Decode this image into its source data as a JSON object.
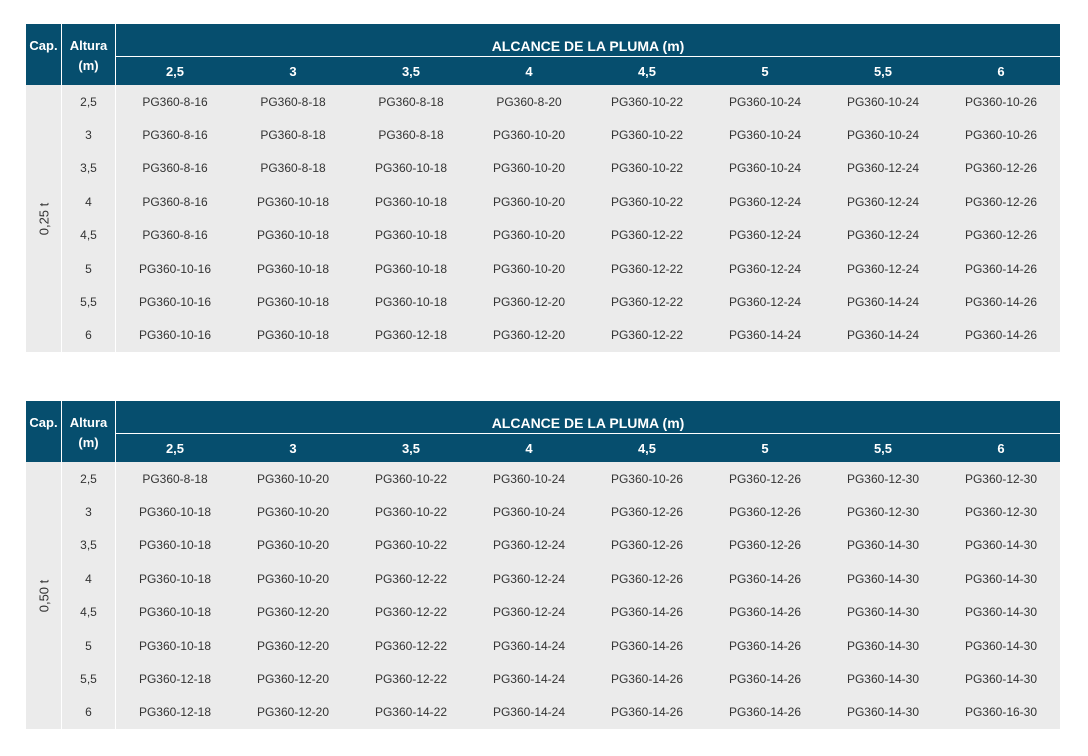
{
  "tables": [
    {
      "cap_header": "Cap.",
      "alt_header_line1": "Altura",
      "alt_header_line2": "(m)",
      "span_header": "ALCANCE DE LA PLUMA (m)",
      "reach": [
        "2,5",
        "3",
        "3,5",
        "4",
        "4,5",
        "5",
        "5,5",
        "6"
      ],
      "capacity": "0,25 t",
      "rows": [
        {
          "altura": "2,5",
          "cells": [
            "PG360-8-16",
            "PG360-8-18",
            "PG360-8-18",
            "PG360-8-20",
            "PG360-10-22",
            "PG360-10-24",
            "PG360-10-24",
            "PG360-10-26"
          ]
        },
        {
          "altura": "3",
          "cells": [
            "PG360-8-16",
            "PG360-8-18",
            "PG360-8-18",
            "PG360-10-20",
            "PG360-10-22",
            "PG360-10-24",
            "PG360-10-24",
            "PG360-10-26"
          ]
        },
        {
          "altura": "3,5",
          "cells": [
            "PG360-8-16",
            "PG360-8-18",
            "PG360-10-18",
            "PG360-10-20",
            "PG360-10-22",
            "PG360-10-24",
            "PG360-12-24",
            "PG360-12-26"
          ]
        },
        {
          "altura": "4",
          "cells": [
            "PG360-8-16",
            "PG360-10-18",
            "PG360-10-18",
            "PG360-10-20",
            "PG360-10-22",
            "PG360-12-24",
            "PG360-12-24",
            "PG360-12-26"
          ]
        },
        {
          "altura": "4,5",
          "cells": [
            "PG360-8-16",
            "PG360-10-18",
            "PG360-10-18",
            "PG360-10-20",
            "PG360-12-22",
            "PG360-12-24",
            "PG360-12-24",
            "PG360-12-26"
          ]
        },
        {
          "altura": "5",
          "cells": [
            "PG360-10-16",
            "PG360-10-18",
            "PG360-10-18",
            "PG360-10-20",
            "PG360-12-22",
            "PG360-12-24",
            "PG360-12-24",
            "PG360-14-26"
          ]
        },
        {
          "altura": "5,5",
          "cells": [
            "PG360-10-16",
            "PG360-10-18",
            "PG360-10-18",
            "PG360-12-20",
            "PG360-12-22",
            "PG360-12-24",
            "PG360-14-24",
            "PG360-14-26"
          ]
        },
        {
          "altura": "6",
          "cells": [
            "PG360-10-16",
            "PG360-10-18",
            "PG360-12-18",
            "PG360-12-20",
            "PG360-12-22",
            "PG360-14-24",
            "PG360-14-24",
            "PG360-14-26"
          ]
        }
      ]
    },
    {
      "cap_header": "Cap.",
      "alt_header_line1": "Altura",
      "alt_header_line2": "(m)",
      "span_header": "ALCANCE DE LA PLUMA (m)",
      "reach": [
        "2,5",
        "3",
        "3,5",
        "4",
        "4,5",
        "5",
        "5,5",
        "6"
      ],
      "capacity": "0,50 t",
      "rows": [
        {
          "altura": "2,5",
          "cells": [
            "PG360-8-18",
            "PG360-10-20",
            "PG360-10-22",
            "PG360-10-24",
            "PG360-10-26",
            "PG360-12-26",
            "PG360-12-30",
            "PG360-12-30"
          ]
        },
        {
          "altura": "3",
          "cells": [
            "PG360-10-18",
            "PG360-10-20",
            "PG360-10-22",
            "PG360-10-24",
            "PG360-12-26",
            "PG360-12-26",
            "PG360-12-30",
            "PG360-12-30"
          ]
        },
        {
          "altura": "3,5",
          "cells": [
            "PG360-10-18",
            "PG360-10-20",
            "PG360-10-22",
            "PG360-12-24",
            "PG360-12-26",
            "PG360-12-26",
            "PG360-14-30",
            "PG360-14-30"
          ]
        },
        {
          "altura": "4",
          "cells": [
            "PG360-10-18",
            "PG360-10-20",
            "PG360-12-22",
            "PG360-12-24",
            "PG360-12-26",
            "PG360-14-26",
            "PG360-14-30",
            "PG360-14-30"
          ]
        },
        {
          "altura": "4,5",
          "cells": [
            "PG360-10-18",
            "PG360-12-20",
            "PG360-12-22",
            "PG360-12-24",
            "PG360-14-26",
            "PG360-14-26",
            "PG360-14-30",
            "PG360-14-30"
          ]
        },
        {
          "altura": "5",
          "cells": [
            "PG360-10-18",
            "PG360-12-20",
            "PG360-12-22",
            "PG360-14-24",
            "PG360-14-26",
            "PG360-14-26",
            "PG360-14-30",
            "PG360-14-30"
          ]
        },
        {
          "altura": "5,5",
          "cells": [
            "PG360-12-18",
            "PG360-12-20",
            "PG360-12-22",
            "PG360-14-24",
            "PG360-14-26",
            "PG360-14-26",
            "PG360-14-30",
            "PG360-14-30"
          ]
        },
        {
          "altura": "6",
          "cells": [
            "PG360-12-18",
            "PG360-12-20",
            "PG360-14-22",
            "PG360-14-24",
            "PG360-14-26",
            "PG360-14-26",
            "PG360-14-30",
            "PG360-16-30"
          ]
        }
      ]
    }
  ],
  "colors": {
    "header_bg": "#064e6e",
    "cell_bg": "#ebebeb"
  }
}
